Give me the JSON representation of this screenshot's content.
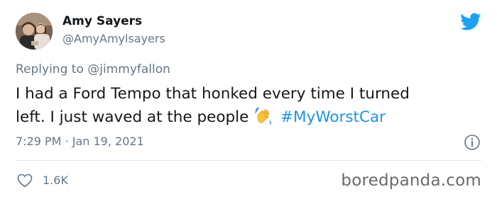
{
  "author": {
    "name": "Amy Sayers",
    "handle": "@AmyAmylsayers"
  },
  "reply": {
    "prefix": "Replying to ",
    "mention": "@jimmyfallon"
  },
  "tweet": {
    "text_line1": "I had a Ford Tempo that honked every time I turned",
    "text_line2": "left. I just waved at the people",
    "emoji": "waving-hand-emoji",
    "hashtag": "#MyWorstCar"
  },
  "meta": {
    "timestamp": "7:29 PM · Jan 19, 2021"
  },
  "actions": {
    "like_count": "1.6K"
  },
  "watermark": "boredpanda.com",
  "colors": {
    "text": "#14171a",
    "secondary": "#657786",
    "link": "#1b95e0",
    "twitter_blue": "#1da1f2",
    "divider": "#e1e8ed"
  },
  "icons": {
    "brand": "twitter-bird-icon",
    "info": "info-icon",
    "like": "heart-icon"
  }
}
